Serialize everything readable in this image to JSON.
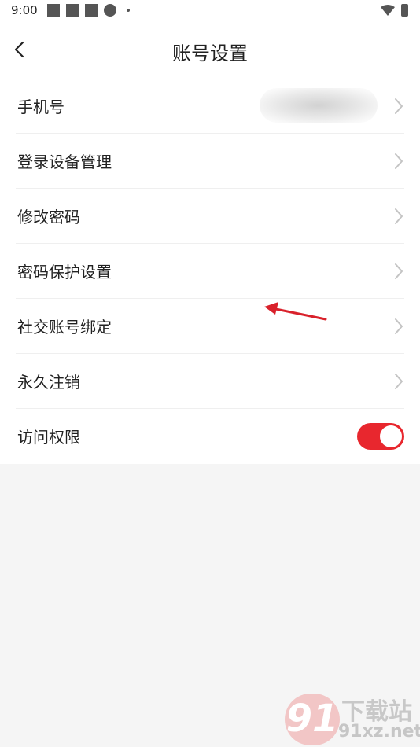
{
  "status_bar": {
    "time": "9:00"
  },
  "header": {
    "title": "账号设置"
  },
  "menu": {
    "items": [
      {
        "label": "手机号"
      },
      {
        "label": "登录设备管理"
      },
      {
        "label": "修改密码"
      },
      {
        "label": "密码保护设置"
      },
      {
        "label": "社交账号绑定"
      },
      {
        "label": "永久注销"
      },
      {
        "label": "访问权限"
      }
    ]
  },
  "toggle": {
    "access_permission_on": true
  },
  "colors": {
    "accent": "#e8272e",
    "background": "#f5f5f5"
  },
  "watermark": {
    "badge": "91",
    "name": "下载站",
    "url": "91xz.net"
  }
}
